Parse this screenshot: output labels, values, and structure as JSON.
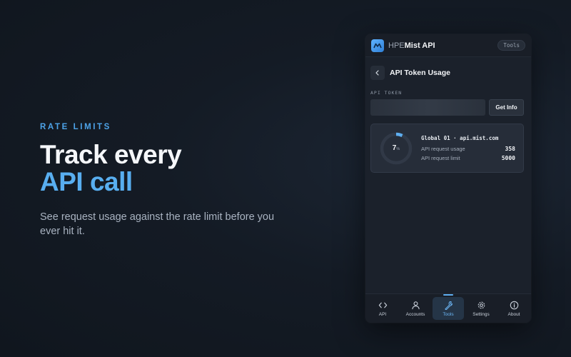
{
  "hero": {
    "eyebrow": "RATE LIMITS",
    "headline_line1": "Track every",
    "headline_line2": "API call",
    "subcopy": "See request usage against the rate limit before you ever hit it."
  },
  "window": {
    "app_title_prefix": "HPE",
    "app_title_main": "Mist API",
    "badge": "Tools",
    "page_title": "API Token Usage",
    "token_label": "API TOKEN",
    "token_value": "",
    "get_info_label": "Get Info"
  },
  "usage": {
    "percent": 7,
    "percent_text": "7",
    "percent_unit": "%",
    "org_line": "Global 01 · api.mist.com",
    "request_usage_label": "API request usage",
    "request_usage_value": "358",
    "request_limit_label": "API request limit",
    "request_limit_value": "5000"
  },
  "nav": [
    {
      "label": "API",
      "icon": "code-icon",
      "active": false
    },
    {
      "label": "Accounts",
      "icon": "person-icon",
      "active": false
    },
    {
      "label": "Tools",
      "icon": "wrench-icon",
      "active": true
    },
    {
      "label": "Settings",
      "icon": "gear-icon",
      "active": false
    },
    {
      "label": "About",
      "icon": "info-icon",
      "active": false
    }
  ],
  "colors": {
    "accent": "#58aef0",
    "gauge_fill": "#5eaef0",
    "gauge_track": "#313947"
  }
}
